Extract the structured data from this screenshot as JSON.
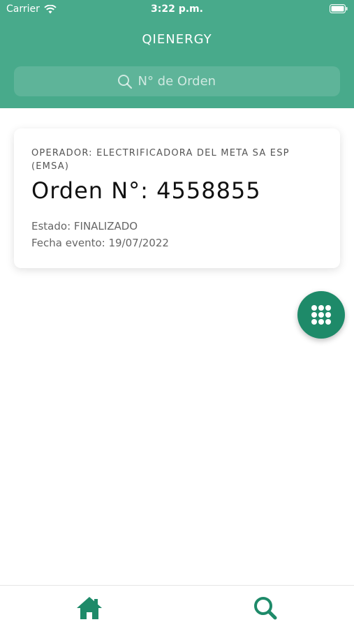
{
  "status_bar": {
    "carrier": "Carrier",
    "time": "3:22 p.m."
  },
  "header": {
    "title": "QIENERGY",
    "search": {
      "placeholder": "N° de Orden",
      "value": ""
    }
  },
  "order_card": {
    "operator": "OPERADOR: ELECTRIFICADORA DEL META SA ESP (EMSA)",
    "order_number": "Orden N°: 4558855",
    "status": "Estado: FINALIZADO",
    "event_date": "Fecha evento: 19/07/2022"
  },
  "fab": {
    "icon": "grid-dots-icon"
  },
  "tab_bar": {
    "items": [
      {
        "icon": "home-icon"
      },
      {
        "icon": "search-icon"
      }
    ]
  },
  "colors": {
    "header_bg": "#48aa8b",
    "accent": "#1e8a69",
    "tab_icon": "#1e8a69"
  }
}
